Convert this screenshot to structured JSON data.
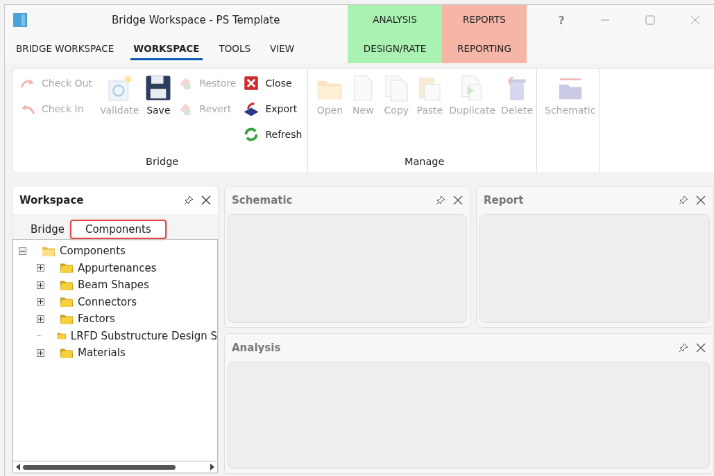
{
  "window": {
    "title": "Bridge Workspace - PS Template",
    "help": "?"
  },
  "menu_tabs": [
    {
      "label": "BRIDGE WORKSPACE",
      "selected": false
    },
    {
      "label": "WORKSPACE",
      "selected": true
    },
    {
      "label": "TOOLS",
      "selected": false
    },
    {
      "label": "VIEW",
      "selected": false
    }
  ],
  "context_groups": [
    {
      "label": "ANALYSIS",
      "tab": "DESIGN/RATE",
      "color": "#a9f2b1"
    },
    {
      "label": "REPORTS",
      "tab": "REPORTING",
      "color": "#f5b6a8"
    }
  ],
  "ribbon_groups": [
    {
      "label": "Bridge",
      "columns": [
        [
          {
            "label": "Check Out",
            "kind": "small",
            "disabled": true
          },
          {
            "label": "Check In",
            "kind": "small",
            "disabled": true
          }
        ],
        [
          {
            "label": "Validate",
            "kind": "large",
            "disabled": true
          }
        ],
        [
          {
            "label": "Save",
            "kind": "large",
            "disabled": false
          }
        ],
        [
          {
            "label": "Restore",
            "kind": "small",
            "disabled": true
          },
          {
            "label": "Revert",
            "kind": "small",
            "disabled": true
          }
        ],
        [
          {
            "label": "Close",
            "kind": "small",
            "disabled": false
          },
          {
            "label": "Export",
            "kind": "small",
            "disabled": false
          },
          {
            "label": "Refresh",
            "kind": "small",
            "disabled": false
          }
        ]
      ]
    },
    {
      "label": "Manage",
      "columns": [
        [
          {
            "label": "Open",
            "kind": "large",
            "disabled": true
          }
        ],
        [
          {
            "label": "New",
            "kind": "large",
            "disabled": true
          }
        ],
        [
          {
            "label": "Copy",
            "kind": "large",
            "disabled": true
          }
        ],
        [
          {
            "label": "Paste",
            "kind": "large",
            "disabled": true
          }
        ],
        [
          {
            "label": "Duplicate",
            "kind": "large",
            "disabled": true
          }
        ],
        [
          {
            "label": "Delete",
            "kind": "large",
            "disabled": true
          }
        ]
      ]
    },
    {
      "columns": [
        [
          {
            "label": "Schematic",
            "kind": "large",
            "disabled": true
          }
        ]
      ]
    }
  ],
  "workspace_panel": {
    "title": "Workspace",
    "tabs": [
      {
        "label": "Bridge",
        "selected": false
      },
      {
        "label": "Components",
        "selected": true
      }
    ],
    "tree": [
      {
        "label": "Components",
        "expanded": true,
        "children": [
          {
            "label": "Appurtenances",
            "expandable": true
          },
          {
            "label": "Beam Shapes",
            "expandable": true
          },
          {
            "label": "Connectors",
            "expandable": true
          },
          {
            "label": "Factors",
            "expandable": true
          },
          {
            "label": "LRFD Substructure Design S",
            "expandable": false
          },
          {
            "label": "Materials",
            "expandable": true
          }
        ]
      }
    ]
  },
  "panels": [
    {
      "title": "Schematic"
    },
    {
      "title": "Report"
    },
    {
      "title": "Analysis"
    }
  ]
}
